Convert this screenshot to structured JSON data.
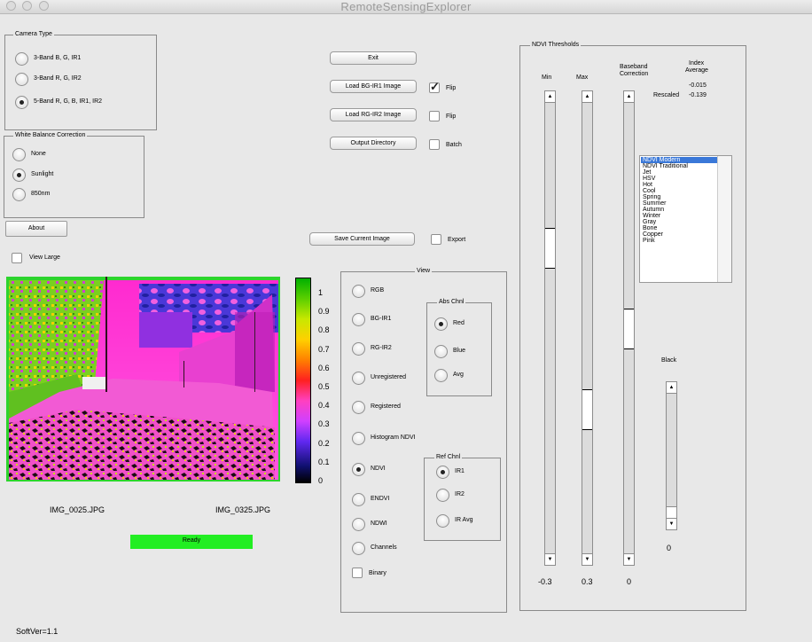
{
  "window": {
    "title": "RemoteSensingExplorer"
  },
  "camera_type": {
    "title": "Camera Type",
    "options": [
      "3-Band B, G, IR1",
      "3-Band R, G, IR2",
      "5-Band R, G, B, IR1, IR2"
    ],
    "selected": 2
  },
  "white_balance": {
    "title": "White Balance Correction",
    "options": [
      "None",
      "Sunlight",
      "850nm"
    ],
    "selected": 1
  },
  "about_label": "About",
  "view_large_label": "View Large",
  "buttons": {
    "exit": "Exit",
    "load_bg": "Load BG-IR1 Image",
    "load_rg": "Load RG-IR2 Image",
    "output_dir": "Output Directory",
    "save_image": "Save Current Image"
  },
  "checks": {
    "flip1": {
      "label": "Flip",
      "checked": true
    },
    "flip2": {
      "label": "Flip",
      "checked": false
    },
    "batch": {
      "label": "Batch",
      "checked": false
    },
    "export": {
      "label": "Export",
      "checked": false
    }
  },
  "images": {
    "left_file": "IMG_0025.JPG",
    "right_file": "IMG_0325.JPG"
  },
  "status": {
    "text": "Ready",
    "color": "#22ee22"
  },
  "colorbar": {
    "ticks": [
      "1",
      "0.9",
      "0.8",
      "0.7",
      "0.6",
      "0.5",
      "0.4",
      "0.3",
      "0.2",
      "0.1",
      "0"
    ]
  },
  "view_panel": {
    "title": "View",
    "options": [
      "RGB",
      "BG-IR1",
      "RG-IR2",
      "Unregistered",
      "Registered",
      "Histogram NDVI",
      "NDVI",
      "ENDVI",
      "NDWI",
      "Channels"
    ],
    "selected": 6,
    "binary_label": "Binary",
    "abs_chnl": {
      "title": "Abs Chnl",
      "options": [
        "Red",
        "Blue",
        "Avg"
      ],
      "selected": 0
    },
    "ref_chnl": {
      "title": "Ref Chnl",
      "options": [
        "IR1",
        "IR2",
        "IR Avg"
      ],
      "selected": 0
    }
  },
  "ndvi": {
    "title": "NDVI Thresholds",
    "min_label": "Min",
    "max_label": "Max",
    "baseband_label_1": "Baseband",
    "baseband_label_2": "Correction",
    "index_label_1": "Index",
    "index_label_2": "Average",
    "index_avg": "-0.015",
    "rescaled_label": "Rescaled",
    "rescaled_val": "-0.139",
    "min_val": "-0.3",
    "max_val": "0.3",
    "baseband_val": "0",
    "black_label": "Black",
    "black_val": "0",
    "colormaps": [
      "NDVI Modern",
      "NDVI Traditional",
      "Jet",
      "HSV",
      "Hot",
      "Cool",
      "Spring",
      "Summer",
      "Autumn",
      "Winter",
      "Gray",
      "Bone",
      "Copper",
      "Pink"
    ],
    "selected_colormap": 0
  },
  "soft_ver": "SoftVer=1.1"
}
